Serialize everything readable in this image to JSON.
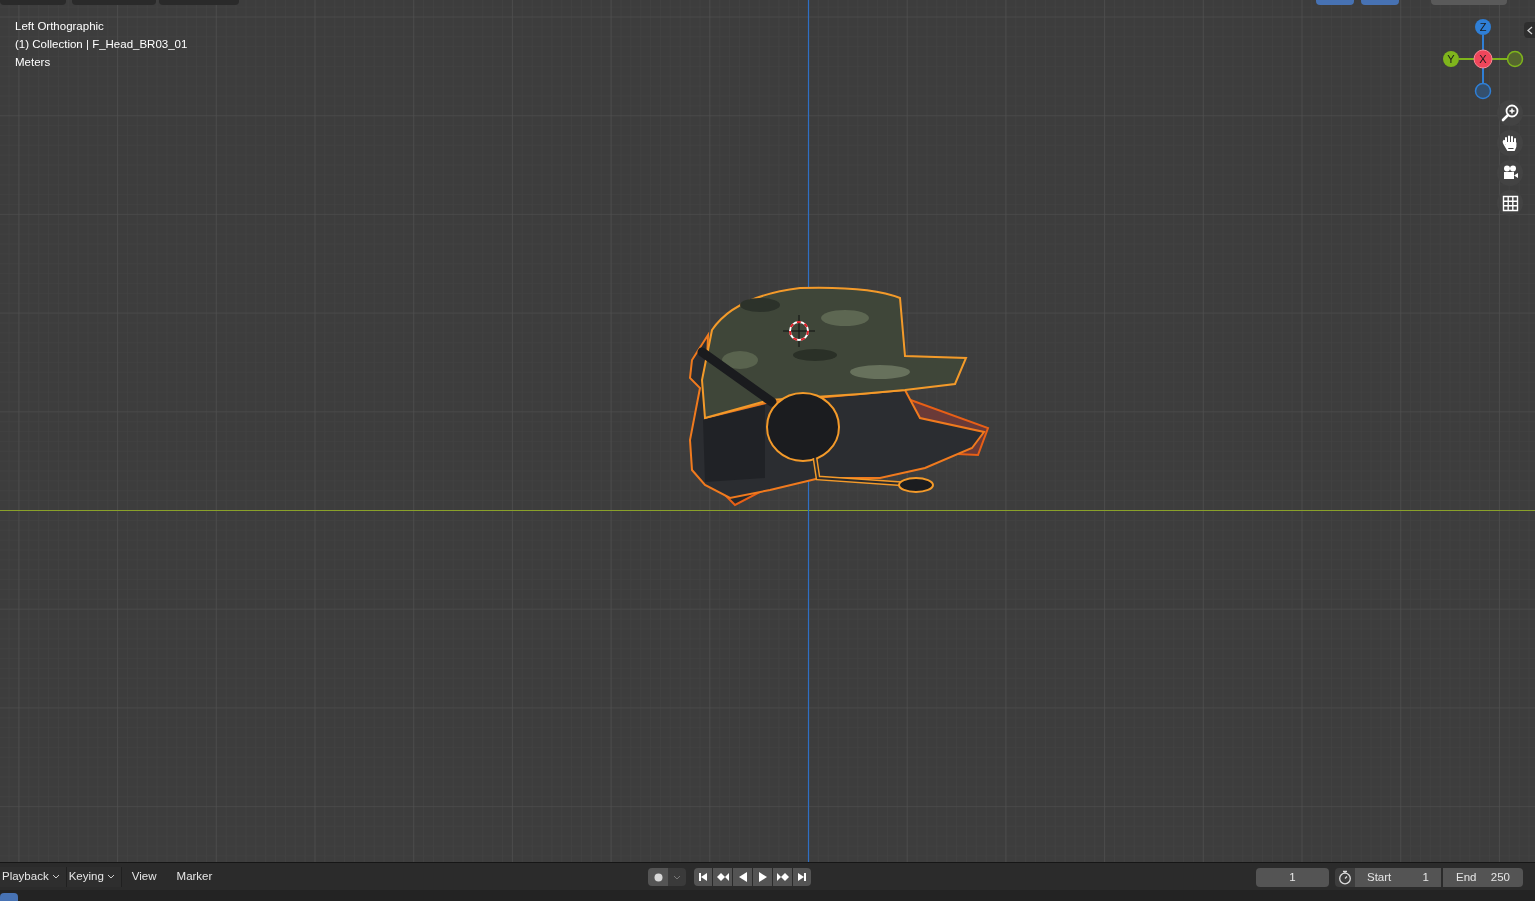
{
  "viewport": {
    "overlay_lines": [
      "Left Orthographic",
      "(1) Collection | F_Head_BR03_01",
      "Meters"
    ]
  },
  "gizmo": {
    "axes": [
      "Z",
      "Y",
      "X"
    ]
  },
  "timeline": {
    "menus": [
      {
        "label": "Playback",
        "dropdown": true
      },
      {
        "label": "Keying",
        "dropdown": true
      },
      {
        "label": "View",
        "dropdown": false
      },
      {
        "label": "Marker",
        "dropdown": false
      }
    ],
    "auto_keying": false,
    "current_frame": "1",
    "start": {
      "label": "Start",
      "value": "1"
    },
    "end": {
      "label": "End",
      "value": "250"
    }
  }
}
